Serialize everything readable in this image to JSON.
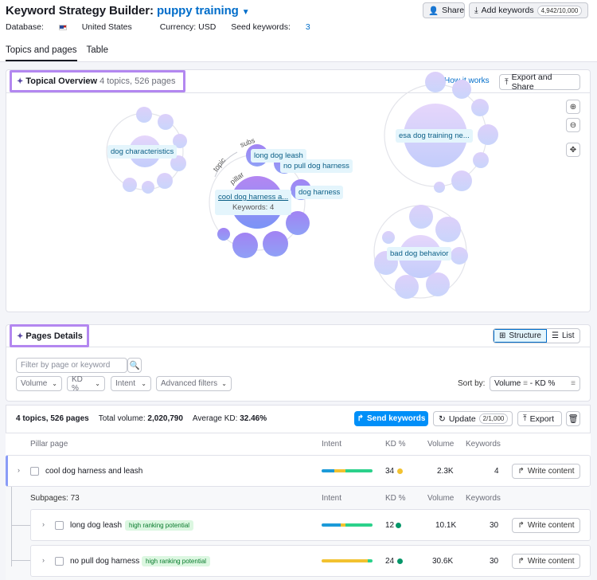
{
  "header": {
    "title_prefix": "Keyword Strategy Builder:",
    "project": "puppy training",
    "database_label": "Database:",
    "database_value": "United States",
    "currency": "Currency: USD",
    "seed_label": "Seed keywords:",
    "seed_value": "3",
    "share_label": "Share",
    "add_keywords_label": "Add keywords",
    "add_keywords_count": "4,942/10,000"
  },
  "tabs": [
    {
      "label": "Topics and pages",
      "active": true
    },
    {
      "label": "Table",
      "active": false
    }
  ],
  "overview": {
    "title": "Topical Overview",
    "subtitle": "4 topics, 526 pages",
    "how_label": "How it works",
    "export_label": "Export and Share",
    "labels": {
      "dog_characteristics": "dog characteristics",
      "long_dog_leash": "long dog leash",
      "no_pull": "no pull dog harness",
      "cool_harness": "cool dog harness a...",
      "cool_keywords": "Keywords: 4",
      "dog_harness": "dog harness",
      "esa": "esa dog training ne...",
      "bad_behavior": "bad dog behavior",
      "arc_topic": "topic",
      "arc_subs": "subs",
      "arc_pillar": "pillar"
    }
  },
  "pages": {
    "title": "Pages Details",
    "structure_label": "Structure",
    "list_label": "List",
    "filter_placeholder": "Filter by page or keyword",
    "filters": [
      "Volume",
      "KD %",
      "Intent",
      "Advanced filters"
    ],
    "sort_label": "Sort by:",
    "sort_value": "Volume",
    "sort_value2": "- KD %",
    "summary_topics": "4 topics, 526 pages",
    "summary_volume_label": "Total volume:",
    "summary_volume": "2,020,790",
    "summary_kd_label": "Average KD:",
    "summary_kd": "32.46%",
    "send_label": "Send keywords",
    "update_label": "Update",
    "update_count": "2/1,000",
    "export_label": "Export",
    "cols": {
      "pillar": "Pillar page",
      "intent": "Intent",
      "kd": "KD %",
      "volume": "Volume",
      "keywords": "Keywords"
    },
    "subcols": {
      "subpages": "Subpages: 73"
    },
    "write_label": "Write content",
    "rows": [
      {
        "name": "cool dog harness and leash",
        "kd": "34",
        "volume": "2.3K",
        "keywords": "4",
        "tag": ""
      },
      {
        "name": "long dog leash",
        "kd": "12",
        "volume": "10.1K",
        "keywords": "30",
        "tag": "high ranking potential"
      },
      {
        "name": "no pull dog harness",
        "kd": "24",
        "volume": "30.6K",
        "keywords": "30",
        "tag": "high ranking potential"
      }
    ]
  },
  "colors": {
    "accent": "#006dca",
    "highlight": "#b387f0",
    "kd_easy": "#059669",
    "kd_mid": "#f2c230"
  }
}
